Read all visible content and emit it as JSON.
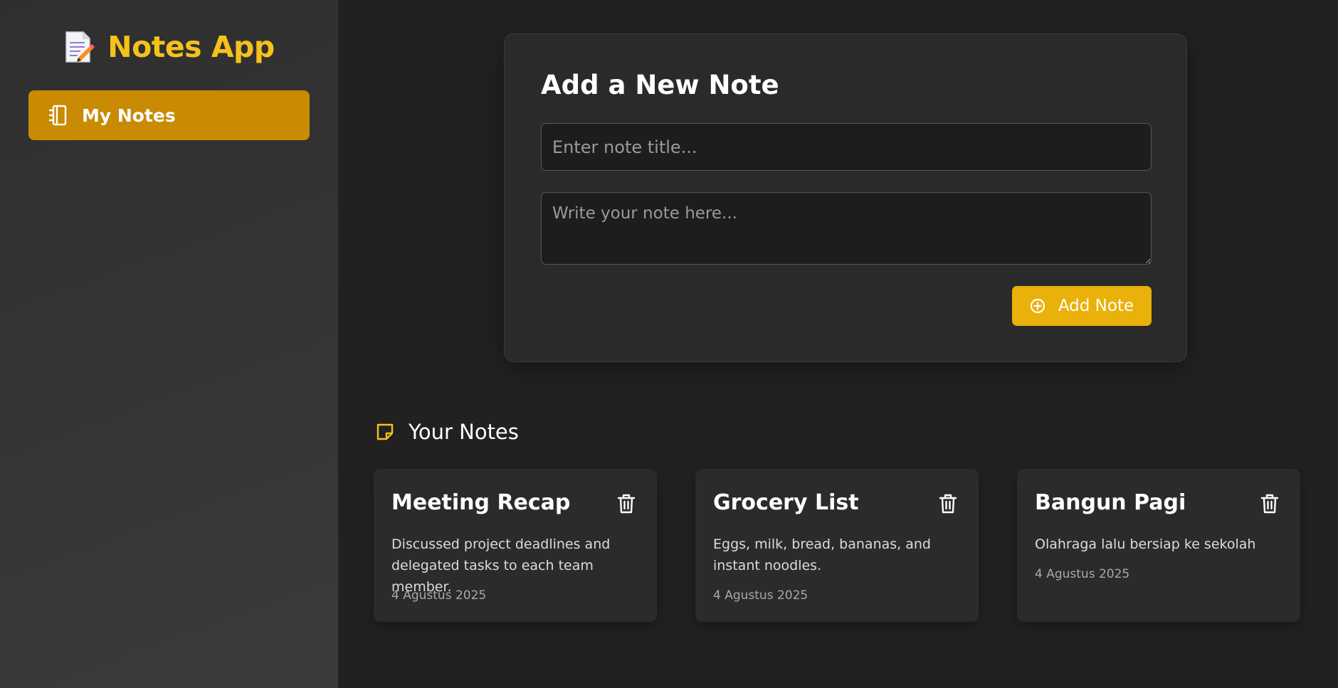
{
  "app": {
    "title": "Notes App"
  },
  "sidebar": {
    "items": [
      {
        "label": "My Notes",
        "icon": "notebook-icon",
        "active": true
      }
    ]
  },
  "form": {
    "heading": "Add a New Note",
    "title_placeholder": "Enter note title...",
    "title_value": "",
    "body_placeholder": "Write your note here...",
    "body_value": "",
    "submit_label": "Add Note"
  },
  "notes_section": {
    "heading": "Your Notes"
  },
  "notes": [
    {
      "title": "Meeting Recap",
      "body": "Discussed project deadlines and delegated tasks to each team member.",
      "date": "4 Agustus 2025"
    },
    {
      "title": "Grocery List",
      "body": "Eggs, milk, bread, bananas, and instant noodles.",
      "date": "4 Agustus 2025"
    },
    {
      "title": "Bangun Pagi",
      "body": "Olahraga lalu bersiap ke sekolah",
      "date": "4 Agustus 2025"
    }
  ],
  "colors": {
    "accent": "#f5c21b",
    "nav_active": "#c98a04",
    "button": "#eab10b",
    "background": "#212121",
    "card": "#2a2a2a"
  }
}
